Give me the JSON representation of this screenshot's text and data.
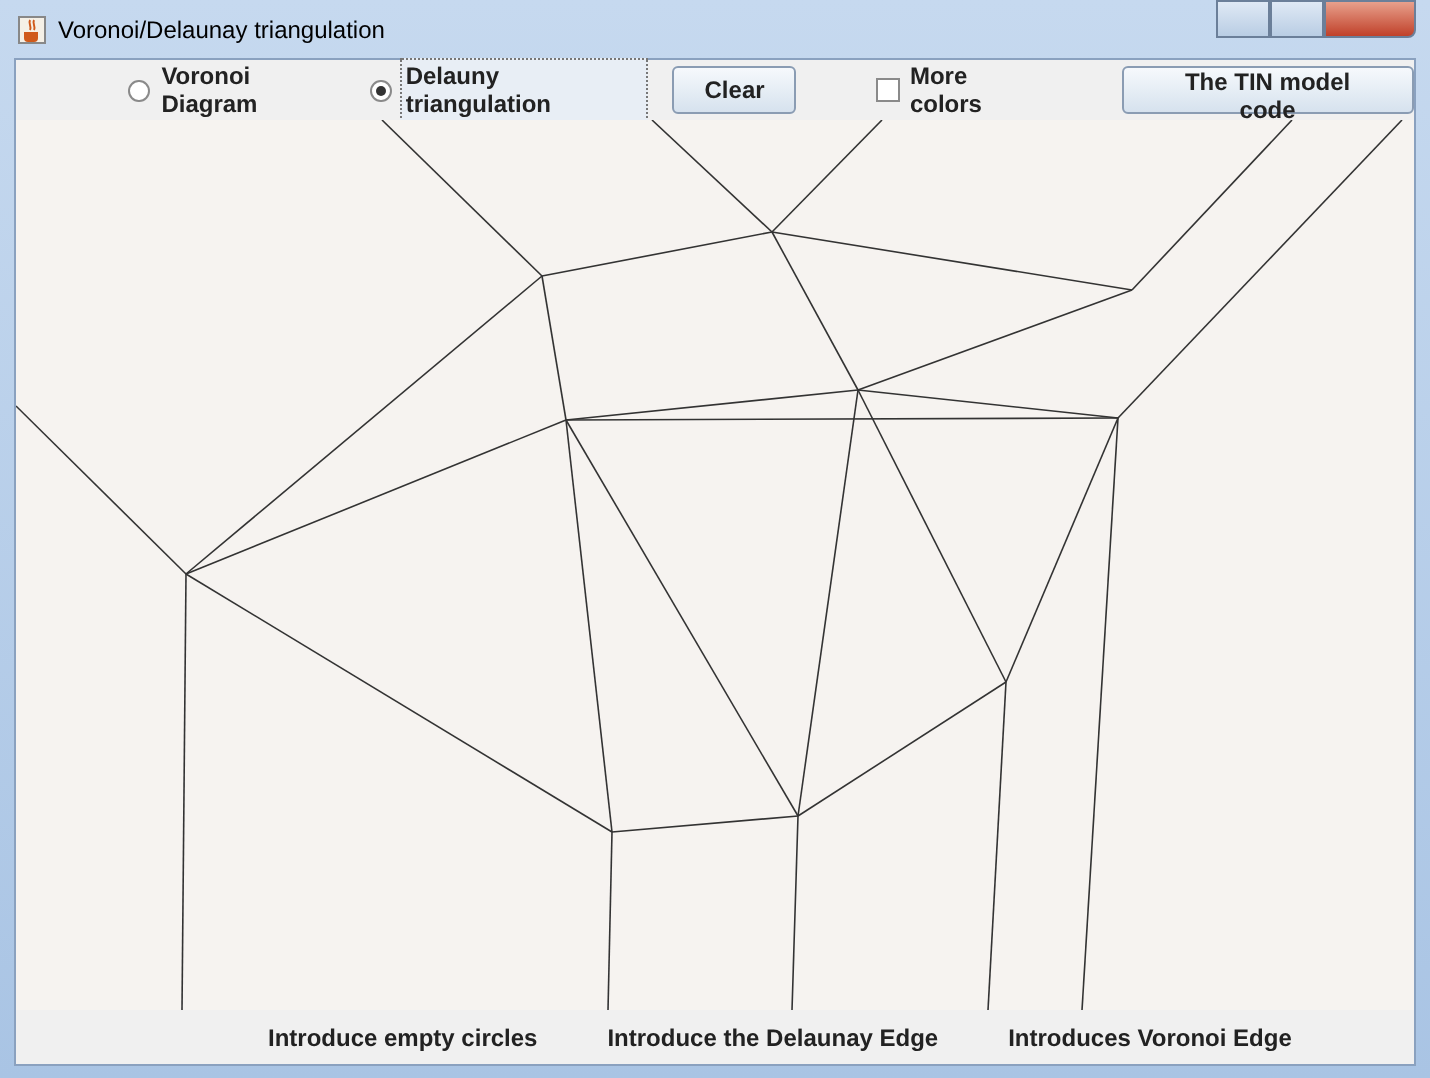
{
  "window": {
    "title": "Voronoi/Delaunay triangulation"
  },
  "toolbar": {
    "modes": [
      {
        "label": "Voronoi Diagram",
        "selected": false
      },
      {
        "label": "Delauny triangulation",
        "selected": true
      }
    ],
    "clear_button": "Clear",
    "more_colors": {
      "label": "More colors",
      "checked": false
    },
    "code_button": "The TIN model code"
  },
  "bottom_bar": [
    "Introduce empty circles",
    "Introduce the Delaunay Edge",
    "Introduces Voronoi Edge"
  ]
}
